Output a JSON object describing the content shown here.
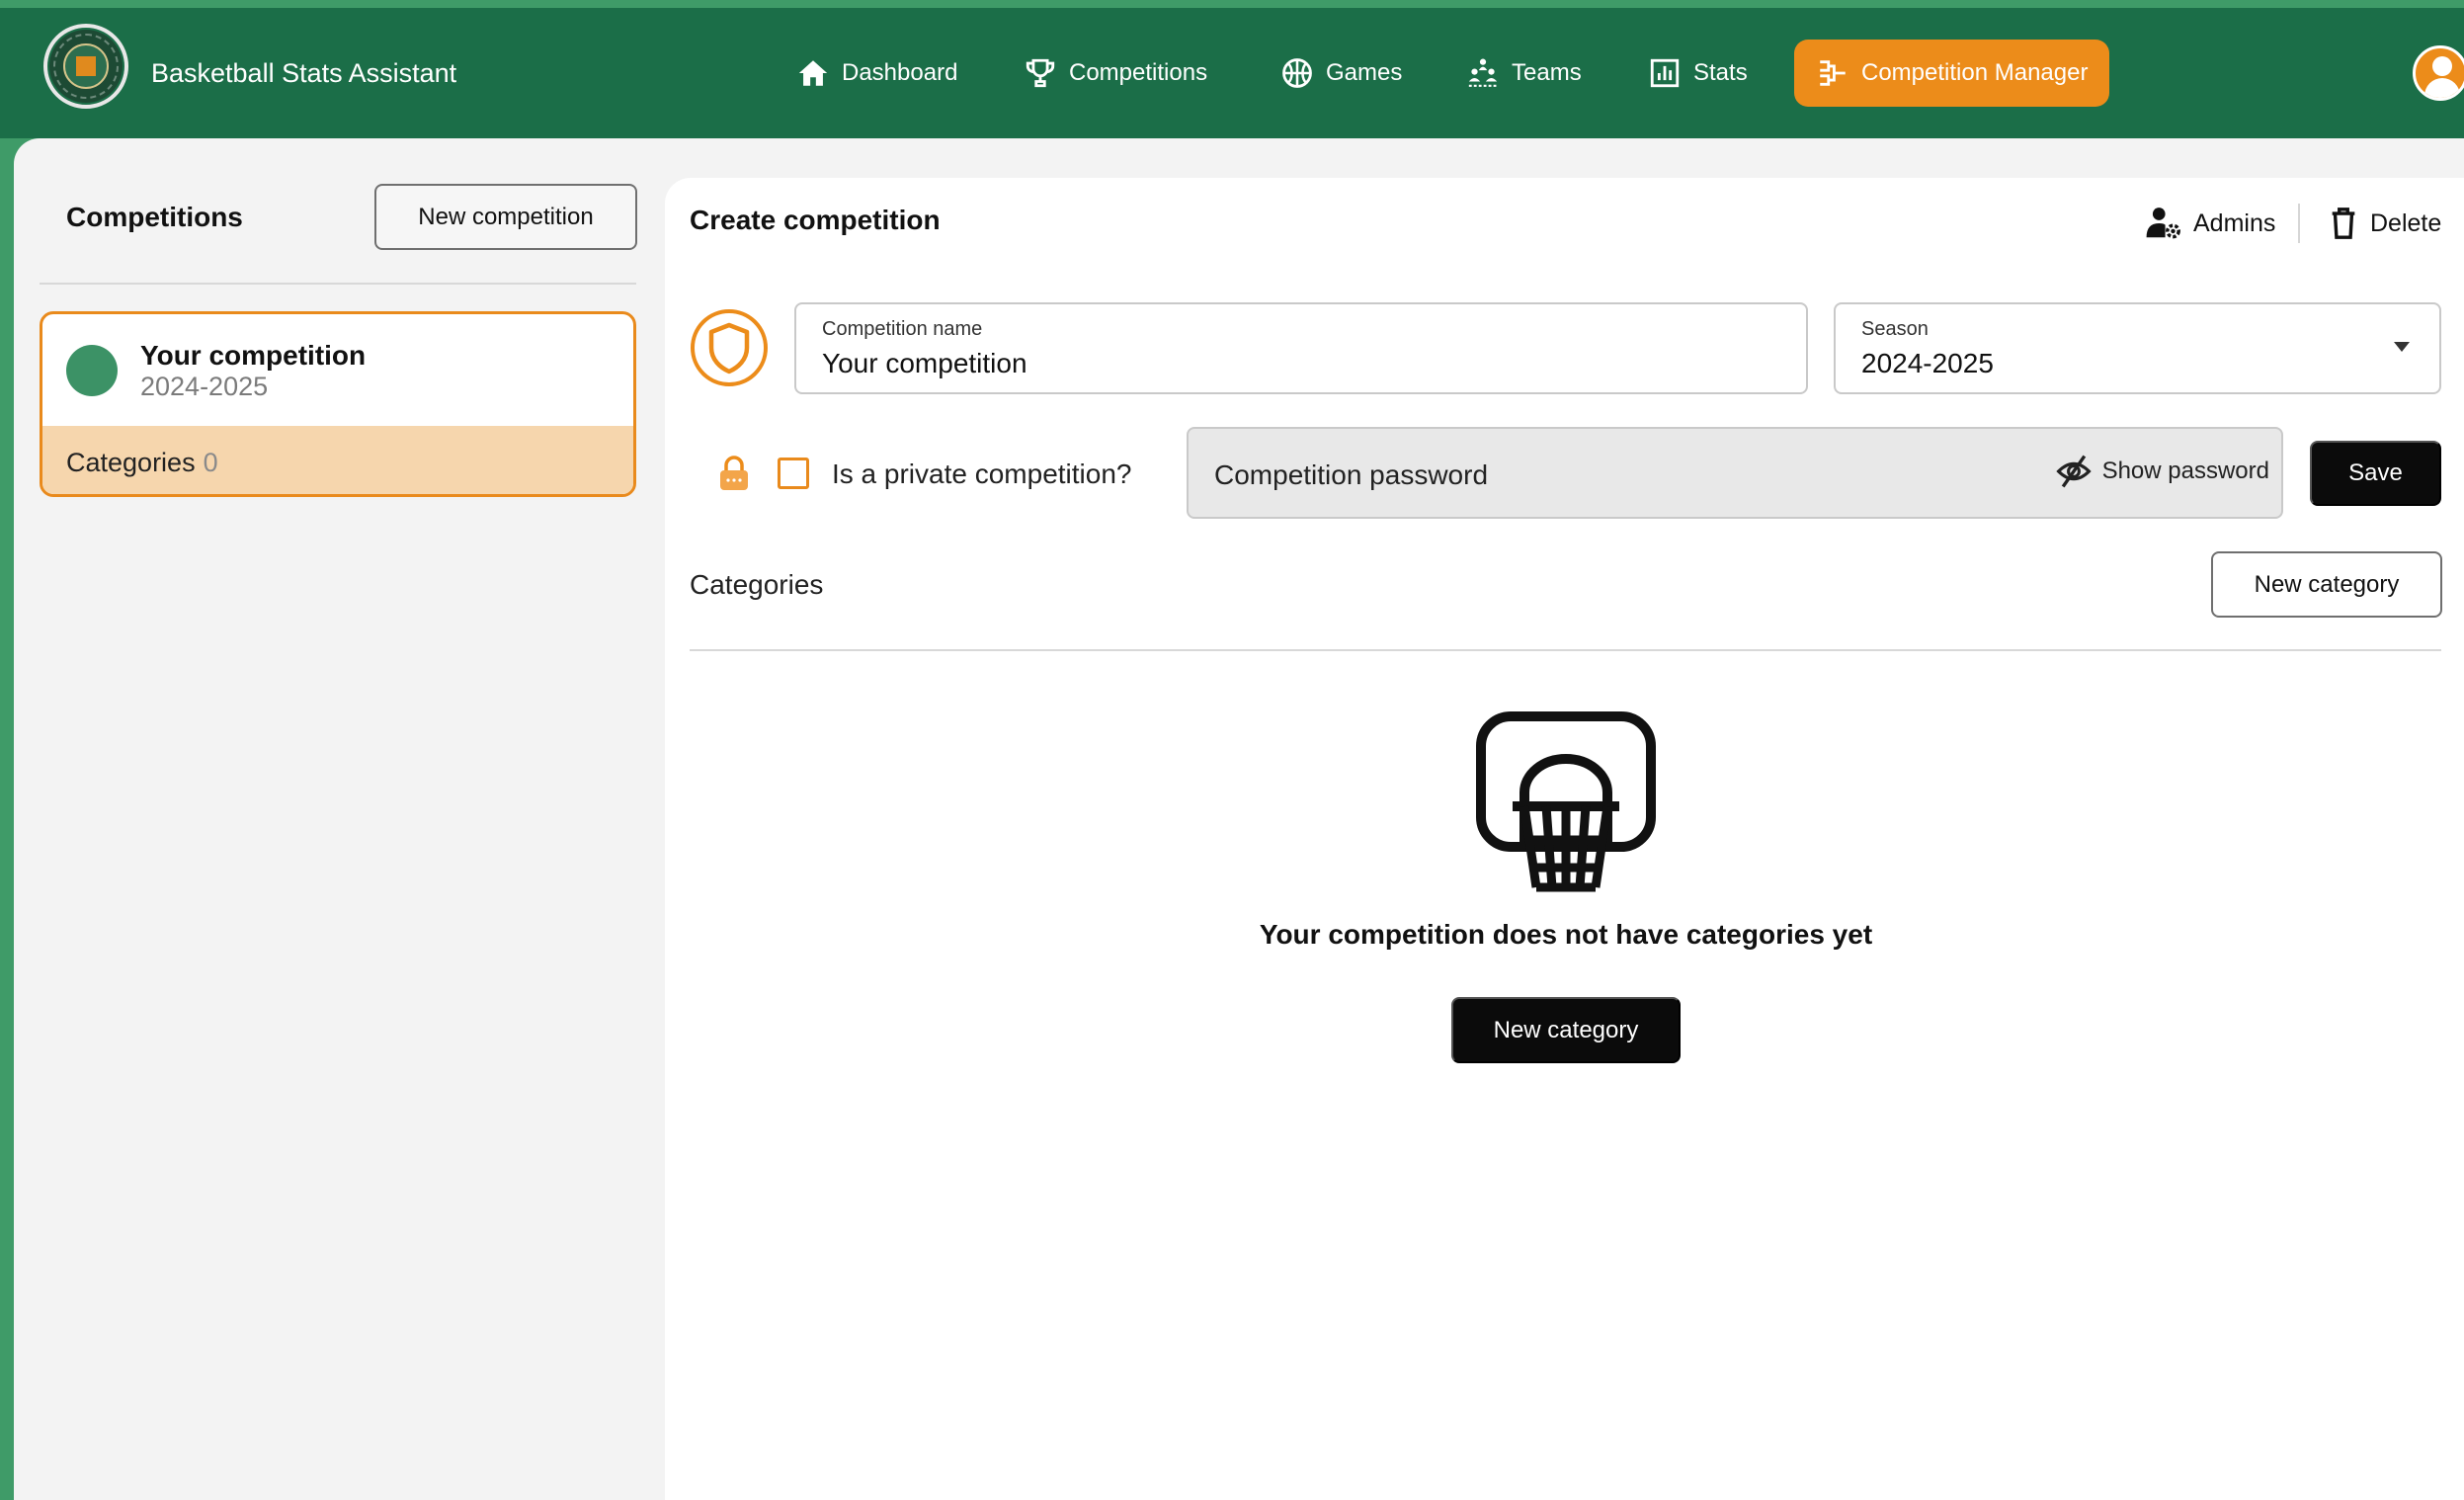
{
  "app": {
    "title": "Basketball Stats Assistant"
  },
  "nav": {
    "items": [
      {
        "label": "Dashboard",
        "icon": "home-icon"
      },
      {
        "label": "Competitions",
        "icon": "trophy-icon"
      },
      {
        "label": "Games",
        "icon": "basketball-icon"
      },
      {
        "label": "Teams",
        "icon": "team-icon"
      },
      {
        "label": "Stats",
        "icon": "bar-chart-icon"
      },
      {
        "label": "Competition Manager",
        "icon": "bracket-icon",
        "active": true
      }
    ]
  },
  "sidebar": {
    "title": "Competitions",
    "new_button": "New competition",
    "competition": {
      "name": "Your competition",
      "season": "2024-2025",
      "categories_label": "Categories",
      "categories_count": "0"
    }
  },
  "main": {
    "title": "Create competition",
    "admins_label": "Admins",
    "delete_label": "Delete",
    "name_field": {
      "label": "Competition name",
      "value": "Your competition"
    },
    "season_field": {
      "label": "Season",
      "value": "2024-2025"
    },
    "private_label": "Is a private competition?",
    "password_placeholder": "Competition password",
    "show_password_label": "Show password",
    "save_label": "Save",
    "categories_heading": "Categories",
    "new_category_label": "New category",
    "empty_message": "Your competition does not have categories yet",
    "empty_new_category_label": "New category"
  },
  "colors": {
    "header": "#1b6e48",
    "accent": "#ec8c1a",
    "competition_dot": "#3c9266",
    "categories_bg": "#f6d6ad"
  }
}
